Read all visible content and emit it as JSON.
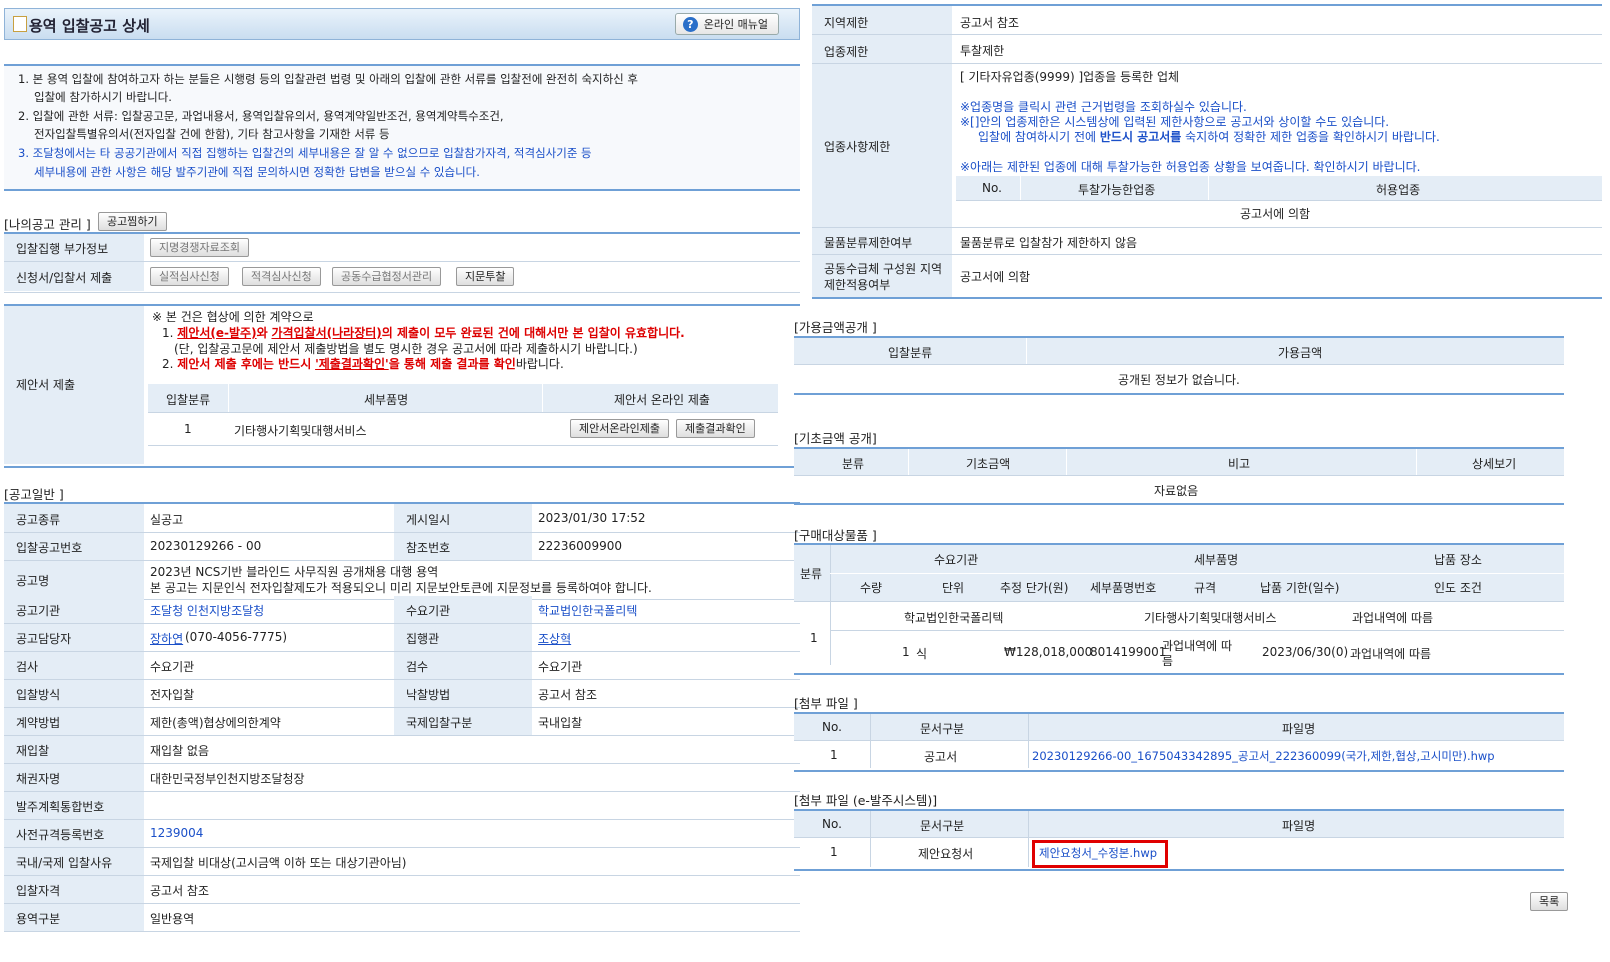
{
  "header": {
    "title": "용역 입찰공고 상세",
    "manual_btn": "온라인 매뉴얼"
  },
  "notice": {
    "l1a": "1. 본 용역 입찰에 참여하고자 하는 분들은 시행령 등의 입찰관련 법령 및 아래의 입찰에 관한 서류를 입찰전에 완전히 숙지하신 후",
    "l1b": "입찰에 참가하시기 바랍니다.",
    "l2a": "2. 입찰에 관한 서류: 입찰공고문, 과업내용서, 용역입찰유의서, 용역계약일반조건, 용역계약특수조건,",
    "l2b": "전자입찰특별유의서(전자입찰 건에 한함), 기타 참고사항을 기재한 서류 등",
    "l3a": "3. 조달청에서는 타 공공기관에서 직접 집행하는 입찰건의 세부내용은 잘 알 수 없으므로 입찰참가자격, 적격심사기준 등",
    "l3b": "세부내용에 관한 사항은 해당 발주기관에 직접 문의하시면 정확한 답변을 받으실 수 있습니다."
  },
  "my_notice": {
    "title": "[나의공고 관리 ]",
    "btn": "공고찜하기"
  },
  "exec_info": {
    "label": "입찰집행 부가정보",
    "btn": "지명경쟁자료조회"
  },
  "submit": {
    "label": "신청서/입찰서 제출",
    "btns": [
      "실적심사신청",
      "적격심사신청",
      "공동수급협정서관리",
      "지문투찰"
    ]
  },
  "proposal": {
    "label": "제안서 제출",
    "head": "※ 본 건은 협상에 의한 계약으로",
    "l1_num": "1.",
    "l1_red1": "제안서(e-발주)",
    "l1_mid": "와",
    "l1_red2": "가격입찰서(나라장터)",
    "l1_tail": "의 제출이 모두 완료된 건에 대해서만 본 입찰이 유효합니다.",
    "l1_sub": "(단, 입찰공고문에 제안서 제출방법을 별도 명시한 경우 공고서에 따라 제출하시기 바랍니다.)",
    "l2_num": "2.",
    "l2_red": "제안서 제출 후에는 반드시",
    "l2_link": "'제출결과확인'",
    "l2_red2": "을 통해 제출 결과를 확인",
    "l2_tail": "바랍니다.",
    "cols": [
      "입찰분류",
      "세부품명",
      "제안서 온라인 제출"
    ],
    "row": {
      "no": "1",
      "item": "기타행사기획및대행서비스",
      "btn1": "제안서온라인제출",
      "btn2": "제출결과확인"
    }
  },
  "general": {
    "title": "[공고일반 ]",
    "rows": [
      {
        "l1": "공고종류",
        "v1": "실공고",
        "l2": "게시일시",
        "v2": "2023/01/30 17:52"
      },
      {
        "l1": "입찰공고번호",
        "v1": "20230129266 - 00",
        "l2": "참조번호",
        "v2": "22236009900"
      }
    ],
    "name_label": "공고명",
    "name_v1": "2023년 NCS기반 블라인드 사무직원 공개채용 대행 용역",
    "name_v2": "본 공고는 지문인식 전자입찰제도가 적용되오니 미리 지문보안토큰에 지문정보를 등록하여야 합니다.",
    "rows2": [
      {
        "l1": "공고기관",
        "v1": "조달청 인천지방조달청",
        "l2": "수요기관",
        "v2": "학교법인한국폴리텍"
      },
      {
        "l1": "공고담당자",
        "v1a": "장하연",
        "v1b": " (070-4056-7775)",
        "l2": "집행관",
        "v2": "조상혁"
      },
      {
        "l1": "검사",
        "v1": "수요기관",
        "l2": "검수",
        "v2": "수요기관"
      },
      {
        "l1": "입찰방식",
        "v1": "전자입찰",
        "l2": "낙찰방법",
        "v2": "공고서 참조"
      },
      {
        "l1": "계약방법",
        "v1": "제한(총액)협상에의한계약",
        "l2": "국제입찰구분",
        "v2": "국내입찰"
      }
    ],
    "rows3": [
      {
        "l": "재입찰",
        "v": "재입찰 없음"
      },
      {
        "l": "채권자명",
        "v": "대한민국정부인천지방조달청장"
      },
      {
        "l": "발주계획통합번호",
        "v": ""
      },
      {
        "l": "사전규격등록번호",
        "v": "1239004"
      },
      {
        "l": "국내/국제 입찰사유",
        "v": "국제입찰 비대상(고시금액 이하 또는 대상기관아님)"
      },
      {
        "l": "입찰자격",
        "v": "공고서 참조"
      },
      {
        "l": "용역구분",
        "v": "일반용역"
      }
    ]
  },
  "right": {
    "region_label": "지역제한",
    "region_val": "공고서 참조",
    "industry_label": "업종제한",
    "industry_val": "투찰제한",
    "detail_label": "업종사항제한",
    "detail_l1": "[ 기타자유업종(9999) ]업종을 등록한 업체",
    "detail_n1": "※업종명을 클릭시 관련 근거법령을 조회하실수 있습니다.",
    "detail_n2a": "※[]안의 업종제한은 시스템상에 입력된 제한사항으로 공고서와 상이할 수도 있습니다.",
    "detail_n2b_1": "입찰에 참여하시기 전에 ",
    "detail_n2b_bold": "반드시 공고서를",
    "detail_n2b_2": " 숙지하여 정확한 제한 업종을 확인하시기 바랍니다.",
    "detail_n3": "※아래는 제한된 업종에 대해 투찰가능한 허용업종 상황을 보여줍니다. 확인하시기 바랍니다.",
    "detail_cols": [
      "No.",
      "투찰가능한업종",
      "허용업종"
    ],
    "detail_row": "공고서에 의함",
    "goods_label": "물품분류제한여부",
    "goods_val": "물품분류로 입찰참가 제한하지 않음",
    "joint_label1": "공동수급체 구성원 지역",
    "joint_label2": "제한적용여부",
    "joint_val": "공고서에 의함",
    "avail_title": "[가용금액공개 ]",
    "avail_cols": [
      "입찰분류",
      "가용금액"
    ],
    "avail_empty": "공개된 정보가 없습니다.",
    "base_title": "[기초금액 공개]",
    "base_cols": [
      "분류",
      "기초금액",
      "비고",
      "상세보기"
    ],
    "base_empty": "자료없음",
    "purchase_title": "[구매대상물품 ]",
    "purchase_h1": [
      "분류",
      "수요기관",
      "세부품명",
      "납품 장소"
    ],
    "purchase_h2": [
      "수량",
      "단위",
      "추정 단가(원)",
      "세부품명번호",
      "규격",
      "납품 기한(일수)",
      "인도 조건"
    ],
    "purchase_row_no": "1",
    "purchase_r1": [
      "학교법인한국폴리텍",
      "기타행사기획및대행서비스",
      "과업내역에 따름"
    ],
    "purchase_r2": [
      "1",
      "식",
      "₩128,018,000",
      "8014199001",
      "과업내역에 따",
      "름",
      "2023/06/30(0)",
      "과업내역에 따름"
    ],
    "attach_title": "[첨부 파일 ]",
    "attach_cols": [
      "No.",
      "문서구분",
      "파일명"
    ],
    "attach_row": [
      "1",
      "공고서",
      "20230129266-00_1675043342895_공고서_222360099(국가,제한,협상,고시미만).hwp"
    ],
    "attach2_title": "[첨부 파일 (e-발주시스템)]",
    "attach2_cols": [
      "No.",
      "문서구분",
      "파일명"
    ],
    "attach2_row": [
      "1",
      "제안요청서",
      "제안요청서_수정본.hwp"
    ],
    "list_btn": "목록"
  }
}
